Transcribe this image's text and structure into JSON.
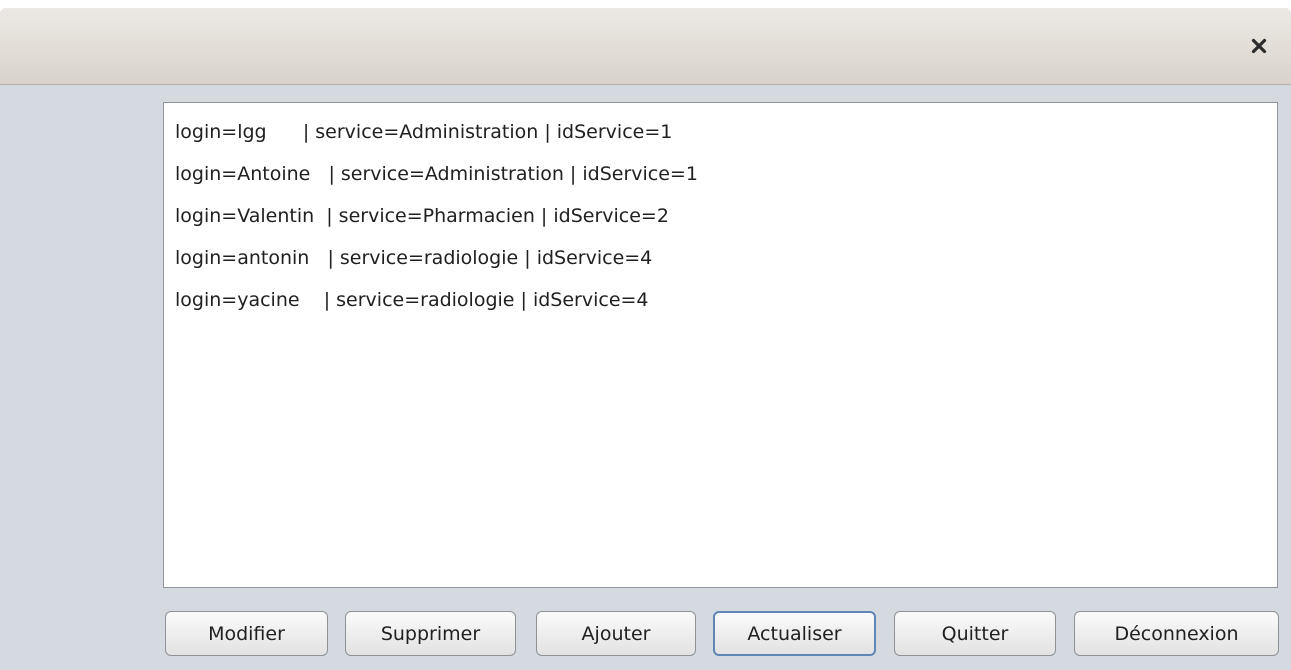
{
  "window": {
    "close_icon": "close-icon"
  },
  "users_list": {
    "rows": [
      "login=lgg      | service=Administration | idService=1",
      "login=Antoine   | service=Administration | idService=1",
      "login=Valentin  | service=Pharmacien | idService=2",
      "login=antonin   | service=radiologie | idService=4",
      "login=yacine    | service=radiologie | idService=4"
    ]
  },
  "buttons": {
    "modifier": "Modifier",
    "supprimer": "Supprimer",
    "ajouter": "Ajouter",
    "actualiser": "Actualiser",
    "quitter": "Quitter",
    "deconnexion": "Déconnexion"
  },
  "colors": {
    "window_bg": "#d5d9e0",
    "focus_border": "#5f86b5"
  }
}
